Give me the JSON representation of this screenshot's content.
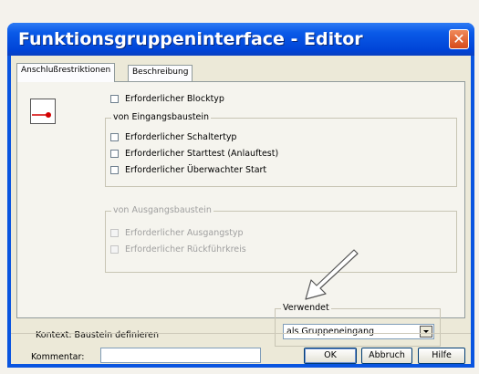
{
  "window": {
    "title": "Funktionsgruppeninterface - Editor"
  },
  "tabs": [
    {
      "label": "Anschlußrestriktionen",
      "active": true
    },
    {
      "label": "Beschreibung",
      "active": false
    }
  ],
  "restrictions": {
    "blocktype_label": "Erforderlicher Blocktyp",
    "input_group": {
      "legend": "von Eingangsbaustein",
      "items": [
        "Erforderlicher Schaltertyp",
        "Erforderlicher Starttest (Anlauftest)",
        "Erforderlicher Überwachter Start"
      ]
    },
    "output_group": {
      "legend": "von Ausgangsbaustein",
      "items": [
        "Erforderlicher Ausgangstyp",
        "Erforderlicher Rückführkreis"
      ]
    }
  },
  "context_label": "Kontext: Baustein definieren",
  "usage": {
    "legend": "Verwendet",
    "selected": "als Gruppeneingang"
  },
  "footer": {
    "comment_label": "Kommentar:",
    "comment_value": "",
    "ok_label": "OK",
    "cancel_label": "Abbruch",
    "help_label": "Hilfe"
  },
  "colors": {
    "titlebar": "#0a55e0",
    "dialog_bg": "#ece9d8",
    "close": "#d64a1a",
    "block_indicator": "#d40000"
  }
}
